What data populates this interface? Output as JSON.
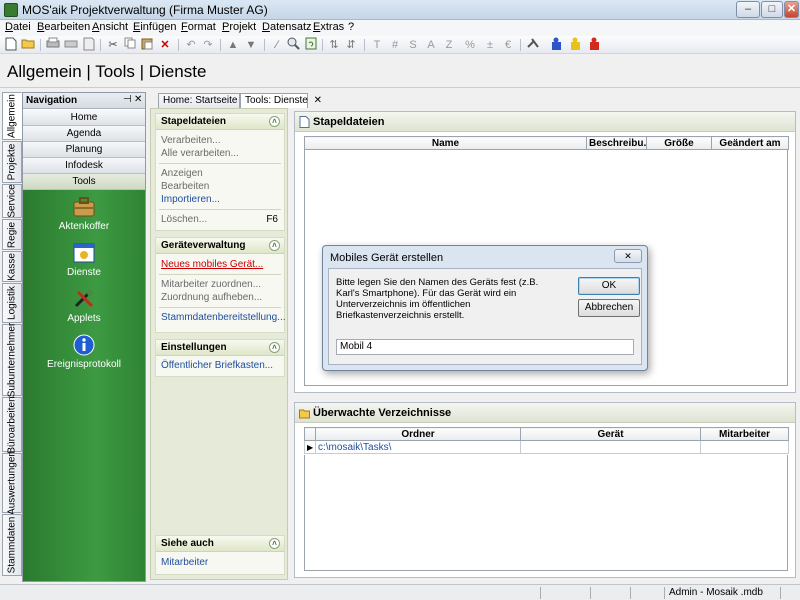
{
  "window": {
    "title": "MOS'aik Projektverwaltung (Firma Muster AG)",
    "minimize": "–",
    "maximize": "□",
    "close": "✕"
  },
  "menu": [
    "Datei",
    "Bearbeiten",
    "Ansicht",
    "Einfügen",
    "Format",
    "Projekt",
    "Datensatz",
    "Extras",
    "?"
  ],
  "toolbar": {
    "text_tools": [
      "T",
      "#",
      "S",
      "A",
      "Z",
      "%"
    ]
  },
  "page_title": "Allgemein | Tools | Dienste",
  "vertical_tabs": [
    "Allgemein",
    "Projekte",
    "Service",
    "Regie",
    "Kasse",
    "Logistik",
    "Subunternehmer",
    "Büroarbeiten",
    "Auswertungen",
    "Stammdaten"
  ],
  "navigation": {
    "header": "Navigation",
    "pin": "⊣",
    "close": "✕",
    "buttons": [
      "Home",
      "Agenda",
      "Planung",
      "Infodesk",
      "Tools"
    ],
    "items": [
      "Aktenkoffer",
      "Dienste",
      "Applets",
      "Ereignisprotokoll"
    ]
  },
  "doc_tabs": [
    "Home: Startseite",
    "Tools: Dienste"
  ],
  "doc_tab_close": "✕",
  "task_pane": {
    "stapeldateien": {
      "title": "Stapeldateien",
      "items": [
        "Verarbeiten...",
        "Alle verarbeiten...",
        "Anzeigen",
        "Bearbeiten",
        "Importieren...",
        "Löschen..."
      ],
      "shortcut": "F6"
    },
    "geraeteverwaltung": {
      "title": "Geräteverwaltung",
      "items": [
        "Neues mobiles Gerät...",
        "Mitarbeiter zuordnen...",
        "Zuordnung aufheben...",
        "Stammdatenbereitstellung..."
      ]
    },
    "einstellungen": {
      "title": "Einstellungen",
      "items": [
        "Öffentlicher Briefkasten..."
      ]
    },
    "siehe_auch": {
      "title": "Siehe auch",
      "items": [
        "Mitarbeiter"
      ]
    },
    "collapse_glyph": "˄"
  },
  "panel_stapeldateien": {
    "title": "Stapeldateien",
    "columns": [
      "Name",
      "Beschreibu...",
      "Größe",
      "Geändert am"
    ]
  },
  "panel_verzeichnisse": {
    "title": "Überwachte Verzeichnisse",
    "columns": [
      "Ordner",
      "Gerät",
      "Mitarbeiter"
    ],
    "rows": [
      {
        "marker": "▶",
        "ordner": "c:\\mosaik\\Tasks\\",
        "geraet": "",
        "mitarbeiter": ""
      }
    ]
  },
  "dialog": {
    "title": "Mobiles Gerät erstellen",
    "close": "✕",
    "text": "Bitte legen Sie den Namen des Geräts fest (z.B. Karl's Smartphone). Für das Gerät wird ein Unterverzeichnis im öffentlichen Briefkastenverzeichnis erstellt.",
    "ok": "OK",
    "cancel": "Abbrechen",
    "input_value": "Mobil 4"
  },
  "statusbar": {
    "user_db": "Admin - Mosaik .mdb"
  },
  "colors": {
    "nav_green": "#3d9a42",
    "link_blue": "#1f4e9e",
    "link_red": "#cc0000"
  }
}
